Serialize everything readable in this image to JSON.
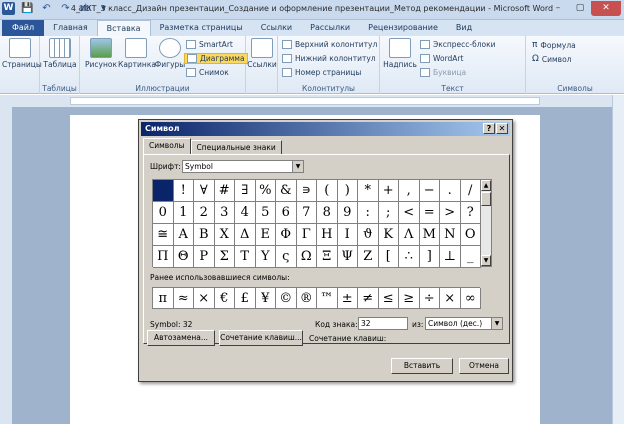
{
  "window": {
    "title": "4_ИКТ_3 класс_Дизайн презентации_Создание и оформление презентации_Метод рекомендации  -  Microsoft Word",
    "minimize": "–",
    "maximize": "▢",
    "close": "✕"
  },
  "qat": [
    "W",
    "💾",
    "↶",
    "↷",
    "ab",
    "▾"
  ],
  "tabs": [
    "Файл",
    "Главная",
    "Вставка",
    "Разметка страницы",
    "Ссылки",
    "Рассылки",
    "Рецензирование",
    "Вид"
  ],
  "ribbon": {
    "pages": {
      "label": "Страницы",
      "group": ""
    },
    "tables": {
      "label": "Таблица",
      "group": "Таблицы"
    },
    "illustrations": {
      "picture": "Рисунок",
      "clipart": "Картинка",
      "shapes": "Фигуры",
      "smartart": "SmartArt",
      "chart": "Диаграмма",
      "screenshot": "Снимок",
      "group": "Иллюстрации"
    },
    "links": {
      "label": "Ссылки",
      "group": ""
    },
    "headers": {
      "header": "Верхний колонтитул",
      "footer": "Нижний колонтитул",
      "pagenum": "Номер страницы",
      "group": "Колонтитулы"
    },
    "text": {
      "textbox": "Надпись",
      "quickparts": "Экспресс-блоки",
      "wordart": "WordArt",
      "dropcap": "Буквица",
      "group": "Текст"
    },
    "symbols": {
      "formula": "Формула",
      "symbol": "Символ",
      "group": "Символы"
    }
  },
  "dialog": {
    "title": "Символ",
    "help": "?",
    "close": "✕",
    "tabs": [
      "Символы",
      "Специальные знаки"
    ],
    "font_label": "Шрифт:",
    "font_value": "Symbol",
    "symbols": [
      [
        " ",
        "!",
        "∀",
        "#",
        "∃",
        "%",
        "&",
        "∍",
        "(",
        ")",
        "*",
        "+",
        ",",
        "−",
        ".",
        "/"
      ],
      [
        "0",
        "1",
        "2",
        "3",
        "4",
        "5",
        "6",
        "7",
        "8",
        "9",
        ":",
        ";",
        "<",
        "=",
        ">",
        "?"
      ],
      [
        "≅",
        "Α",
        "Β",
        "Χ",
        "Δ",
        "Ε",
        "Φ",
        "Γ",
        "Η",
        "Ι",
        "ϑ",
        "Κ",
        "Λ",
        "Μ",
        "Ν",
        "Ο"
      ],
      [
        "Π",
        "Θ",
        "Ρ",
        "Σ",
        "Τ",
        "Υ",
        "ς",
        "Ω",
        "Ξ",
        "Ψ",
        "Ζ",
        "[",
        "∴",
        "]",
        "⊥",
        "_"
      ]
    ],
    "recent_label": "Ранее использовавшиеся символы:",
    "recent": [
      "π",
      "≈",
      "×",
      "€",
      "£",
      "¥",
      "©",
      "®",
      "™",
      "±",
      "≠",
      "≤",
      "≥",
      "÷",
      "×",
      "∞"
    ],
    "symbol_info": "Symbol: 32",
    "code_label": "Код знака:",
    "code_value": "32",
    "from_label": "из:",
    "from_value": "Символ (дес.)",
    "autocorrect": "Автозамена...",
    "shortcut_btn": "Сочетание клавиш...",
    "shortcut_label": "Сочетание клавиш:",
    "insert": "Вставить",
    "cancel": "Отмена"
  }
}
